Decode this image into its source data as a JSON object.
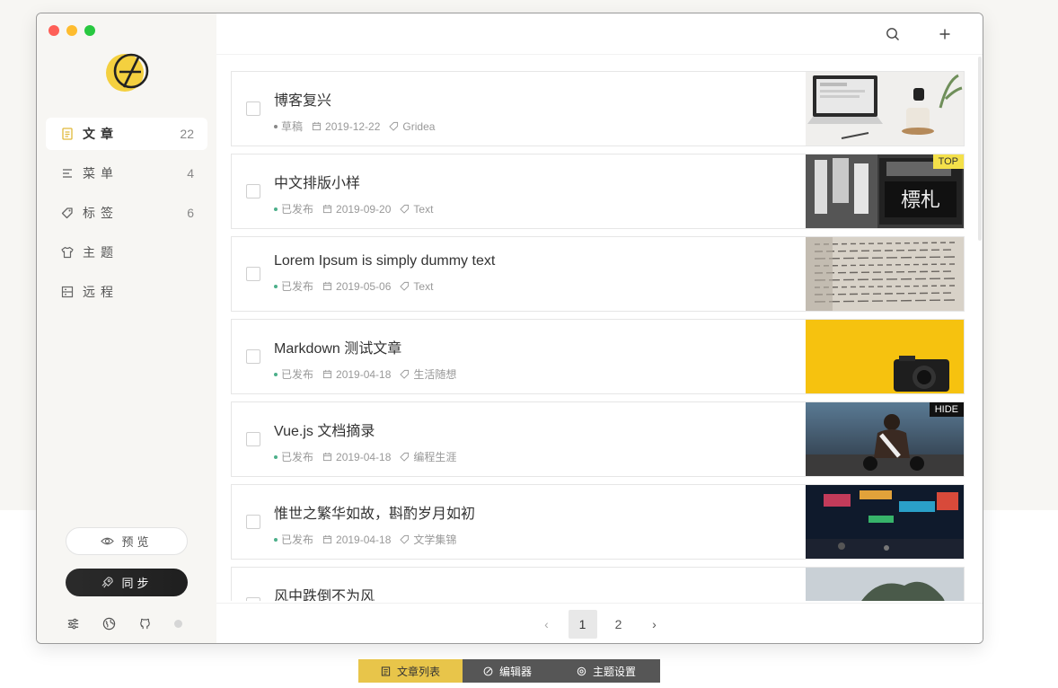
{
  "sidebar": {
    "nav": [
      {
        "label": "文章",
        "count": "22",
        "icon": "article-icon"
      },
      {
        "label": "菜单",
        "count": "4",
        "icon": "menu-icon"
      },
      {
        "label": "标签",
        "count": "6",
        "icon": "tag-icon"
      },
      {
        "label": "主题",
        "count": "",
        "icon": "theme-icon"
      },
      {
        "label": "远程",
        "count": "",
        "icon": "remote-icon"
      }
    ],
    "preview_label": "预览",
    "sync_label": "同步"
  },
  "posts": [
    {
      "title": "博客复兴",
      "status": "草稿",
      "status_color": "#888888",
      "date": "2019-12-22",
      "tag": "Gridea",
      "badge": ""
    },
    {
      "title": "中文排版小样",
      "status": "已发布",
      "status_color": "#4caf8a",
      "date": "2019-09-20",
      "tag": "Text",
      "badge": "TOP"
    },
    {
      "title": "Lorem Ipsum is simply dummy text",
      "status": "已发布",
      "status_color": "#4caf8a",
      "date": "2019-05-06",
      "tag": "Text",
      "badge": ""
    },
    {
      "title": "Markdown 测试文章",
      "status": "已发布",
      "status_color": "#4caf8a",
      "date": "2019-04-18",
      "tag": "生活随想",
      "badge": ""
    },
    {
      "title": "Vue.js 文档摘录",
      "status": "已发布",
      "status_color": "#4caf8a",
      "date": "2019-04-18",
      "tag": "编程生涯",
      "badge": "HIDE"
    },
    {
      "title": "惟世之繁华如故，斟酌岁月如初",
      "status": "已发布",
      "status_color": "#4caf8a",
      "date": "2019-04-18",
      "tag": "文学集锦",
      "badge": ""
    },
    {
      "title": "风中跌倒不为风",
      "status": "",
      "status_color": "#4caf8a",
      "date": "",
      "tag": "",
      "badge": ""
    }
  ],
  "pagination": {
    "pages": [
      "1",
      "2"
    ],
    "current": "1",
    "prev": "‹",
    "next": "›"
  },
  "bottom_tabs": [
    "文章列表",
    "编辑器",
    "主题设置"
  ],
  "colors": {
    "accent": "#f4d03f",
    "sidebar_bg": "#f7f6f3",
    "sync_bg": "#222222"
  }
}
